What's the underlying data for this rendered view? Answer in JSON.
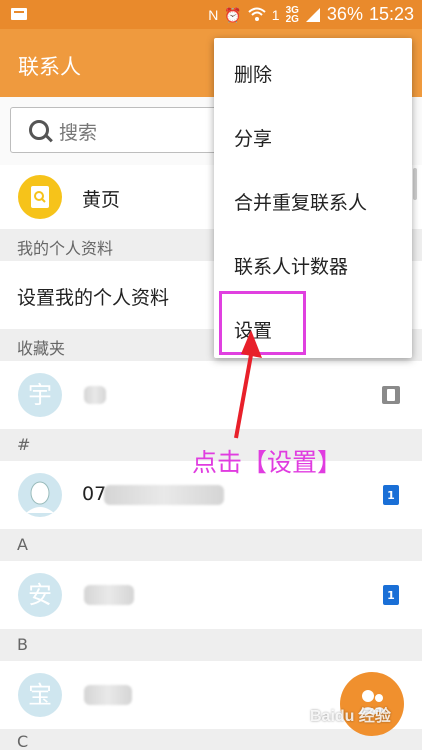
{
  "status_bar": {
    "network_small_top": "3G",
    "network_small_bottom": "2G",
    "battery": "36%",
    "time": "15:23"
  },
  "app_bar": {
    "title": "联系人"
  },
  "search": {
    "placeholder": "搜索"
  },
  "yellow_pages": {
    "label": "黄页"
  },
  "sections": {
    "my_profile": "我的个人资料",
    "favorites": "收藏夹",
    "hash": "#",
    "a": "A",
    "b": "B",
    "c": "C"
  },
  "my_profile_row": {
    "label": "设置我的个人资料"
  },
  "contacts": [
    {
      "avatar_char": "宇",
      "name": ""
    },
    {
      "avatar_char": "",
      "name": "07"
    },
    {
      "avatar_char": "安",
      "name": ""
    },
    {
      "avatar_char": "宝",
      "name": ""
    }
  ],
  "sim_badge": "1",
  "menu": {
    "items": [
      "删除",
      "分享",
      "合并重复联系人",
      "联系人计数器",
      "设置"
    ]
  },
  "annotation": {
    "text": "点击【设置】"
  },
  "colors": {
    "accent": "#ef9a3e",
    "status_bar": "#e98a2c",
    "annotation": "#e03ce0",
    "avatar_bg": "#cfe6ef",
    "sim_blue": "#1a6fd6"
  }
}
